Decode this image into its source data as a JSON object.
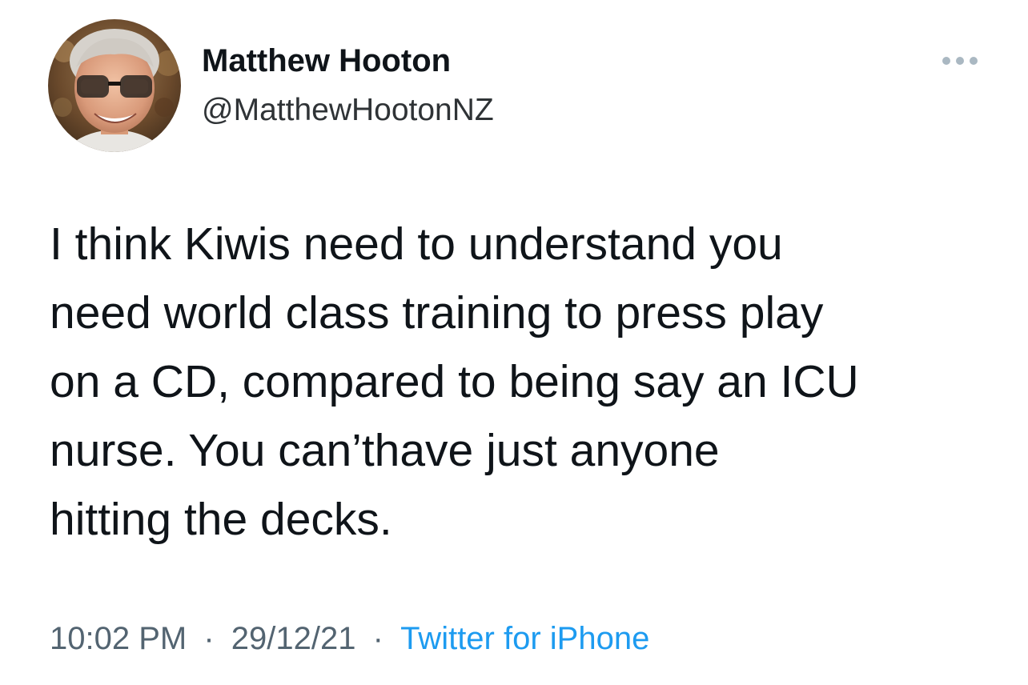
{
  "author": {
    "display_name": "Matthew Hooton",
    "handle": "@MatthewHootonNZ",
    "avatar_icon": "user-avatar-photo"
  },
  "menu": {
    "more_icon": "more-horizontal-icon"
  },
  "tweet": {
    "text": "I think Kiwis need to understand you\nneed world class training to press play\non a CD, compared to being say an ICU\nnurse. You can’thave just anyone\nhitting the decks."
  },
  "meta": {
    "time": "10:02 PM",
    "separator": "·",
    "date": "29/12/21",
    "source": "Twitter for iPhone"
  },
  "colors": {
    "text": "#0f1419",
    "secondary": "#536471",
    "link": "#1d9bf0",
    "background": "#ffffff"
  }
}
